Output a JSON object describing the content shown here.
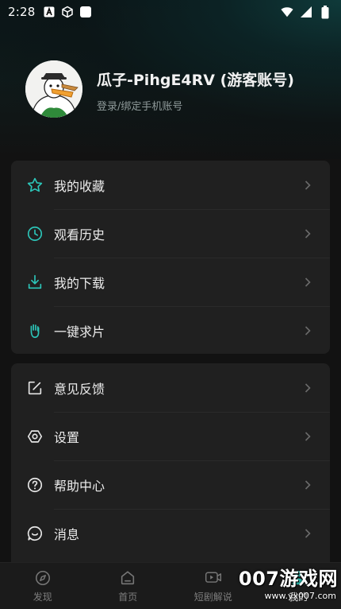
{
  "status_bar": {
    "time": "2:28",
    "left_icons": [
      "font-a-icon",
      "cube-icon",
      "app-square-icon"
    ],
    "right_icons": [
      "wifi-icon",
      "signal-icon",
      "battery-icon"
    ]
  },
  "profile": {
    "name": "瓜子-PihgE4RV (游客账号)",
    "subtitle": "登录/绑定手机账号",
    "avatar": "goose-avatar"
  },
  "menu_group_1": {
    "items": [
      {
        "label": "我的收藏",
        "icon": "star-icon"
      },
      {
        "label": "观看历史",
        "icon": "clock-icon"
      },
      {
        "label": "我的下载",
        "icon": "download-icon"
      },
      {
        "label": "一键求片",
        "icon": "hand-icon"
      }
    ]
  },
  "menu_group_2": {
    "items": [
      {
        "label": "意见反馈",
        "icon": "edit-icon"
      },
      {
        "label": "设置",
        "icon": "settings-icon"
      },
      {
        "label": "帮助中心",
        "icon": "help-icon"
      },
      {
        "label": "消息",
        "icon": "message-icon"
      }
    ]
  },
  "tabbar": {
    "tabs": [
      {
        "label": "发现",
        "icon": "compass-icon"
      },
      {
        "label": "首页",
        "icon": "home-icon"
      },
      {
        "label": "短剧解说",
        "icon": "video-icon"
      },
      {
        "label": "我的",
        "icon": "profile-icon",
        "active": true
      }
    ]
  },
  "watermark": {
    "brand": "007游戏网",
    "url": "www.yx007.com"
  },
  "colors": {
    "accent": "#2cc5b8",
    "background": "#121212",
    "card": "#202020"
  }
}
